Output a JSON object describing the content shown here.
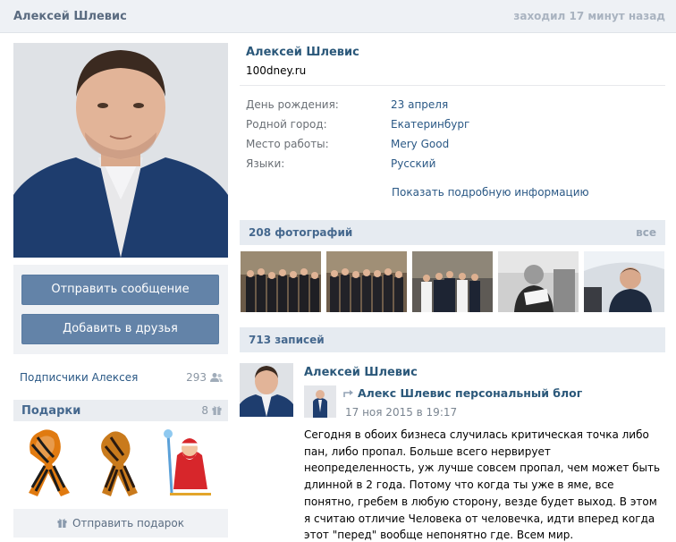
{
  "header": {
    "user_name": "Алексей Шлевис",
    "last_seen": "заходил 17 минут назад"
  },
  "actions": {
    "send_message": "Отправить сообщение",
    "add_friend": "Добавить в друзья"
  },
  "followers": {
    "label": "Подписчики Алексея",
    "count": "293"
  },
  "gifts": {
    "label": "Подарки",
    "count": "8",
    "send_label": "Отправить подарок"
  },
  "profile": {
    "name": "Алексей Шлевис",
    "status": "100dney.ru",
    "info": [
      {
        "key": "День рождения:",
        "value": "23 апреля"
      },
      {
        "key": "Родной город:",
        "value": "Екатеринбург"
      },
      {
        "key": "Место работы:",
        "value": "Mery Good"
      },
      {
        "key": "Языки:",
        "value": "Русский"
      }
    ],
    "more_info": "Показать подробную информацию"
  },
  "photos": {
    "label": "208 фотографий",
    "all_label": "все"
  },
  "posts": {
    "label": "713 записей",
    "post": {
      "author": "Алексей Шлевис",
      "repost_source": "Алекс Шлевис персональный блог",
      "date": "17 ноя 2015 в 19:17",
      "text": "Сегодня в обоих бизнеса случилась критическая точка либо пан, либо пропал. Больше всего нервирует неопределенность, уж лучше совсем пропал, чем может быть длинной в 2 года. Потому что когда ты уже в яме, все понятно, гребем в любую сторону, везде будет выход. В этом я считаю отличие Человека от человечка, идти вперед когда этот \"перед\" вообще непонятно где. Всем мир."
    }
  },
  "colors": {
    "link": "#2a5885",
    "button": "#6383a8",
    "section_header": "#e6ebf1"
  }
}
